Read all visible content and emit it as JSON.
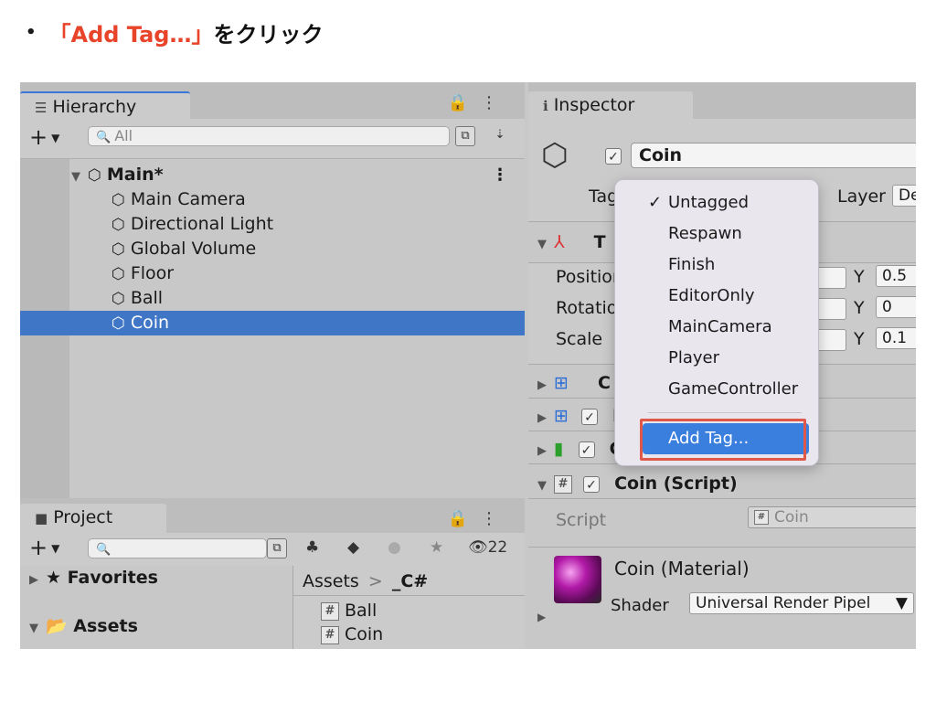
{
  "caption": {
    "bullet": "•",
    "accent": "「Add Tag…」",
    "rest": "をクリック"
  },
  "hierarchy": {
    "tab_label": "Hierarchy",
    "search_placeholder": "All",
    "scene": "Main*",
    "items": [
      "Main Camera",
      "Directional Light",
      "Global Volume",
      "Floor",
      "Ball",
      "Coin"
    ],
    "selected": "Coin"
  },
  "project": {
    "tab_label": "Project",
    "count": "22",
    "favorites": "Favorites",
    "assets": "Assets",
    "breadcrumb_root": "Assets",
    "breadcrumb_sep": ">",
    "breadcrumb_leaf": "_C#",
    "files": [
      "Ball",
      "Coin"
    ]
  },
  "inspector": {
    "tab_label": "Inspector",
    "object_name": "Coin",
    "tag_label": "Tag",
    "layer_label": "Layer",
    "layer_value": "De",
    "transform_initial": "T",
    "rows": [
      {
        "label": "Position",
        "y_label": "Y",
        "y_value": "0.5"
      },
      {
        "label": "Rotation",
        "y_label": "Y",
        "y_value": "0"
      },
      {
        "label": "Scale",
        "y_label": "Y",
        "y_value": "0.1"
      }
    ],
    "comp_collapsed": [
      "C",
      "M",
      "C"
    ],
    "script_component": "Coin (Script)",
    "script_label": "Script",
    "script_value": "Coin",
    "material_name": "Coin (Material)",
    "shader_label": "Shader",
    "shader_value": "Universal Render Pipel"
  },
  "tag_menu": {
    "items": [
      "Untagged",
      "Respawn",
      "Finish",
      "EditorOnly",
      "MainCamera",
      "Player",
      "GameController"
    ],
    "checked": "Untagged",
    "add_tag": "Add Tag..."
  }
}
